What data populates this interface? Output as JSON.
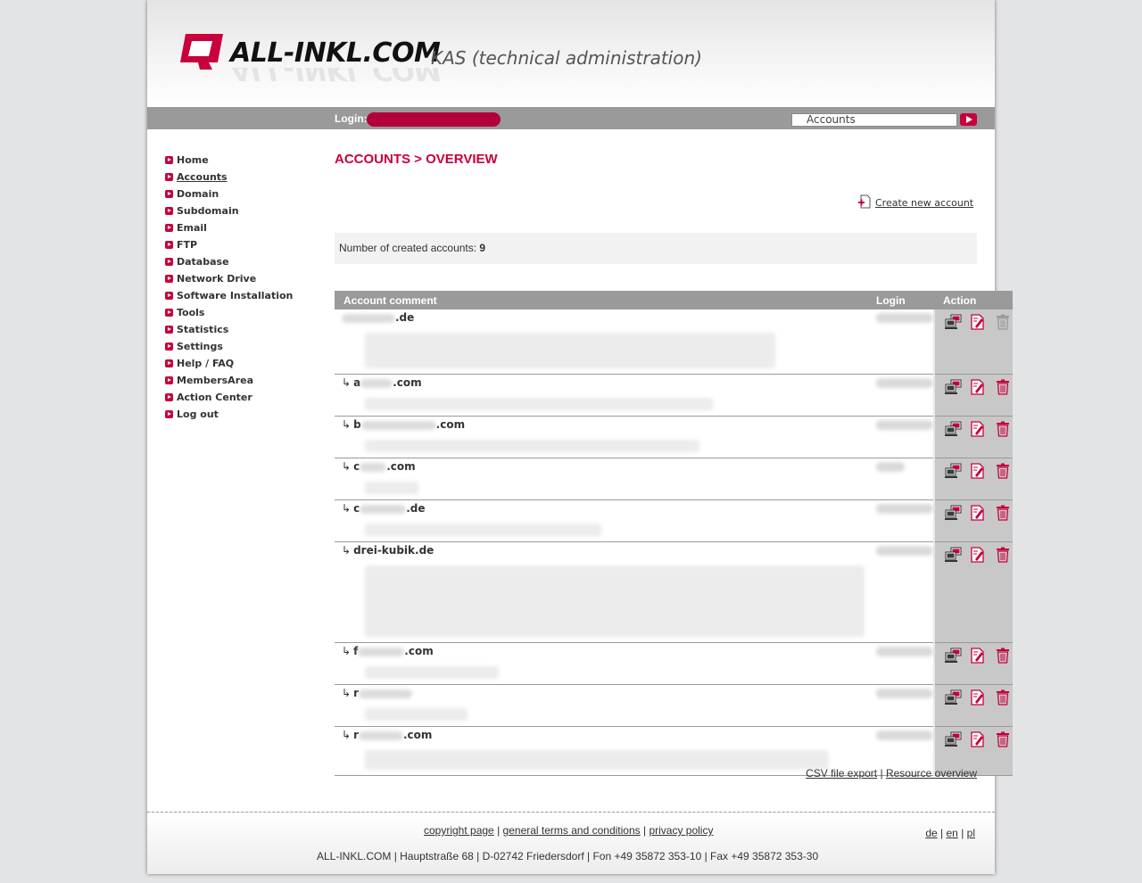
{
  "header": {
    "logo_text": "ALL-INKL.COM",
    "subtitle": "KAS (technical administration)"
  },
  "topbar": {
    "login_label": "Login:",
    "search_value": "Accounts"
  },
  "nav": {
    "items": [
      {
        "label": "Home"
      },
      {
        "label": "Accounts",
        "active": true
      },
      {
        "label": "Domain"
      },
      {
        "label": "Subdomain"
      },
      {
        "label": "Email"
      },
      {
        "label": "FTP"
      },
      {
        "label": "Database"
      },
      {
        "label": "Network Drive"
      },
      {
        "label": "Software Installation"
      },
      {
        "label": "Tools"
      },
      {
        "label": "Statistics"
      },
      {
        "label": "Settings"
      },
      {
        "label": "Help / FAQ"
      },
      {
        "label": "MembersArea"
      },
      {
        "label": "Action Center"
      },
      {
        "label": "Log out"
      }
    ]
  },
  "main": {
    "title": "ACCOUNTS > OVERVIEW",
    "create_label": "Create new account",
    "count_label": "Number of created accounts:",
    "count_value": "9",
    "table": {
      "headers": [
        "Account comment",
        "Login",
        "Action"
      ],
      "rows": [
        {
          "prefix": "",
          "suffix": ".de",
          "arrow": false
        },
        {
          "prefix": "a",
          "suffix": ".com",
          "arrow": true
        },
        {
          "prefix": "b",
          "suffix": ".com",
          "arrow": true
        },
        {
          "prefix": "c",
          "suffix": ".com",
          "arrow": true
        },
        {
          "prefix": "c",
          "suffix": ".de",
          "arrow": true
        },
        {
          "prefix": "drei-kubik.de",
          "suffix": "",
          "arrow": true
        },
        {
          "prefix": "f",
          "suffix": ".com",
          "arrow": true
        },
        {
          "prefix": "r",
          "suffix": "",
          "arrow": true
        },
        {
          "prefix": "r",
          "suffix": ".com",
          "arrow": true
        }
      ]
    },
    "csv_export": "CSV file export",
    "resource_overview": "Resource overview",
    "link_separator": "|"
  },
  "footer": {
    "copyright": "copyright page",
    "terms": "general terms and conditions",
    "privacy": "privacy policy",
    "address": "ALL-INKL.COM | Hauptstraße 68 | D-02742 Friedersdorf | Fon +49 35872 353-10 | Fax +49 35872 353-30",
    "lang_de": "de",
    "lang_en": "en",
    "lang_pl": "pl"
  },
  "colors": {
    "accent": "#c8003c",
    "bar_gray": "#9a9a9a",
    "action_bg": "#c8c8c8"
  }
}
